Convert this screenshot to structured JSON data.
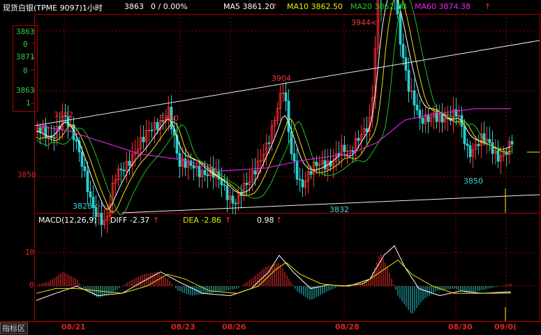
{
  "header": {
    "title": "现货白银(TPME 9097)1小时",
    "last_price": "3863",
    "change": "0 / 0.00%",
    "ma5": "MA5 3861.20",
    "ma5_arrow": "↑",
    "ma10": "MA10 3862.50",
    "ma20": "MA20 3862.10",
    "ma20_arrow": "↓",
    "ma60": "MA60 3874.38",
    "ma60_arrow": "↑"
  },
  "left_box": {
    "lines": [
      "3863",
      "0",
      "3871",
      "0",
      "3863",
      "1"
    ]
  },
  "price_axis": {
    "label_3850": "3850"
  },
  "annotations": {
    "high_3882": "3882",
    "high_3880": "3880",
    "high_3904": "3904",
    "high_3944": "3944<···",
    "low_3828": "3828<···",
    "low_3832": "3832",
    "low_3850": "3850"
  },
  "macd_header": {
    "name": "MACD(12,26,9)",
    "diff": "DIFF  -2.37",
    "diff_arrow": "↑",
    "dea": "DEA  -2.86",
    "dea_arrow": "↑",
    "macd": "0.98",
    "macd_arrow": "↑"
  },
  "macd_axis": {
    "t10": "10",
    "t0": "0"
  },
  "dates": [
    "08/21",
    "08/23",
    "08/26",
    "08/28",
    "08/30",
    "09/0("
  ],
  "bottom_tab": "指标区",
  "colors": {
    "up": "#ff3030",
    "down": "#28d0d0",
    "ma5": "#ffffff",
    "ma10": "#e8e800",
    "ma20": "#20c020",
    "ma60": "#e020e0",
    "grid": "#a00000"
  },
  "chart_data": [
    {
      "type": "candlestick",
      "title": "现货白银(TPME 9097)1小时",
      "ylim": [
        3818,
        3962
      ],
      "series": [
        {
          "name": "MA5",
          "values": [
            3861.2
          ]
        },
        {
          "name": "MA10",
          "values": [
            3862.5
          ]
        },
        {
          "name": "MA20",
          "values": [
            3862.1
          ]
        },
        {
          "name": "MA60",
          "values": [
            3874.38
          ]
        }
      ],
      "annotations": [
        {
          "label": "3882",
          "y": 3882
        },
        {
          "label": "3880",
          "y": 3880
        },
        {
          "label": "3904",
          "y": 3904
        },
        {
          "label": "3944",
          "y": 3944
        },
        {
          "label": "3828",
          "y": 3828
        },
        {
          "label": "3832",
          "y": 3832
        },
        {
          "label": "3850",
          "y": 3850
        }
      ],
      "x_tick_labels": [
        "08/21",
        "08/23",
        "08/26",
        "08/28",
        "08/30",
        "09/0("
      ]
    },
    {
      "type": "bar",
      "title": "MACD(12,26,9)",
      "series": [
        {
          "name": "DIFF",
          "values": [
            -2.37
          ]
        },
        {
          "name": "DEA",
          "values": [
            -2.86
          ]
        },
        {
          "name": "MACD",
          "values": [
            0.98
          ]
        }
      ],
      "y_ticks": [
        10,
        0
      ]
    }
  ]
}
